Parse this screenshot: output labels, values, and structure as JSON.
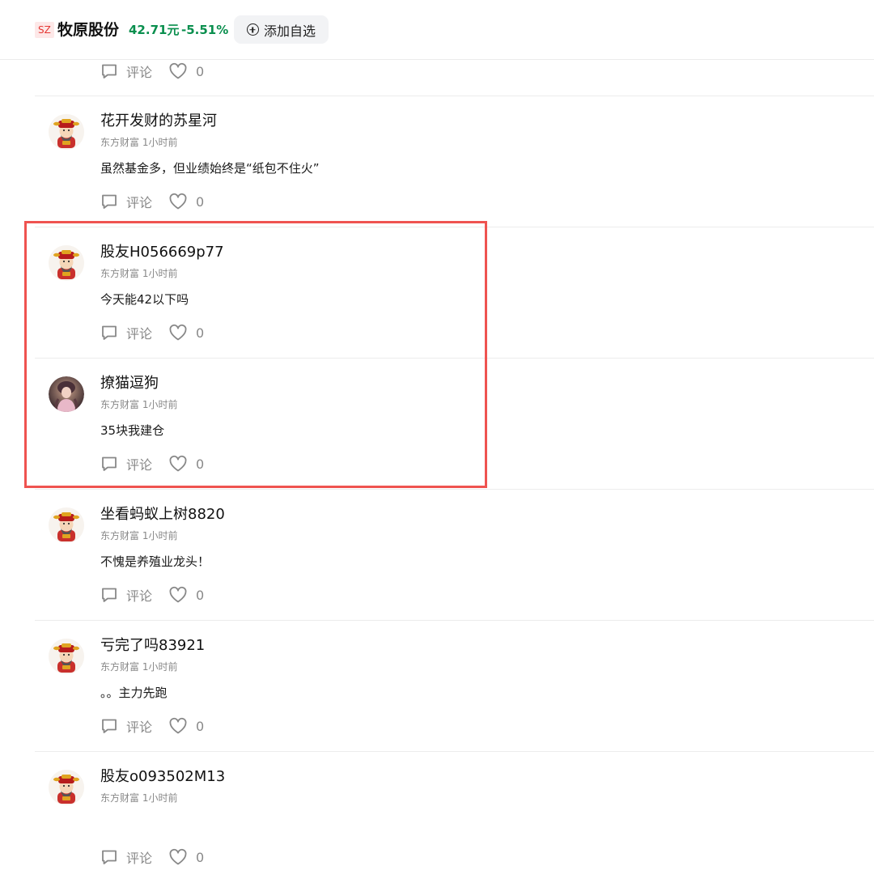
{
  "header": {
    "market": "SZ",
    "stock_name": "牧原股份",
    "price": "42.71元",
    "change": "-5.51%",
    "watch_label": "添加自选"
  },
  "top_actions": {
    "comment_label": "评论",
    "like_count": "0"
  },
  "posts": [
    {
      "username": "花开发财的苏星河",
      "source": "东方财富",
      "time": "1小时前",
      "content": "虽然基金多，但业绩始终是“纸包不住火”",
      "comment_label": "评论",
      "like_count": "0",
      "avatar": "caishen-avatar"
    },
    {
      "username": "股友H056669p77",
      "source": "东方财富",
      "time": "1小时前",
      "content": "今天能42以下吗",
      "comment_label": "评论",
      "like_count": "0",
      "avatar": "caishen-avatar"
    },
    {
      "username": "撩猫逗狗",
      "source": "东方财富",
      "time": "1小时前",
      "content": "35块我建仓",
      "comment_label": "评论",
      "like_count": "0",
      "avatar": "photo-avatar"
    },
    {
      "username": "坐看蚂蚁上树8820",
      "source": "东方财富",
      "time": "1小时前",
      "content": "不愧是养殖业龙头！",
      "comment_label": "评论",
      "like_count": "0",
      "avatar": "caishen-avatar"
    },
    {
      "username": "亏完了吗83921",
      "source": "东方财富",
      "time": "1小时前",
      "content": "。。主力先跑",
      "comment_label": "评论",
      "like_count": "0",
      "avatar": "caishen-avatar"
    },
    {
      "username": "股友o093502M13",
      "source": "东方财富",
      "time": "1小时前",
      "content": "",
      "comment_label": "评论",
      "like_count": "0",
      "avatar": "caishen-avatar"
    }
  ],
  "colors": {
    "price_green": "#0a8f4e",
    "badge_red": "#e53935",
    "highlight_red": "#ef5350"
  }
}
